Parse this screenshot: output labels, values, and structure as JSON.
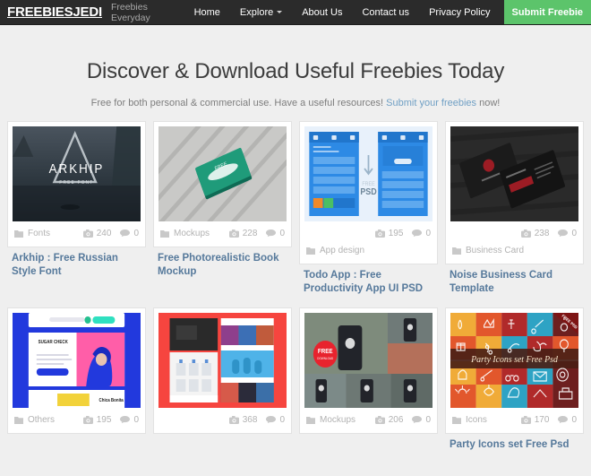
{
  "header": {
    "brand": "FREEBIESJEDI",
    "tagline": "Freebies Everyday",
    "nav": [
      {
        "label": "Home",
        "name": "nav-home",
        "caret": false
      },
      {
        "label": "Explore",
        "name": "nav-explore",
        "caret": true
      },
      {
        "label": "About Us",
        "name": "nav-about-us",
        "caret": false
      },
      {
        "label": "Contact us",
        "name": "nav-contact-us",
        "caret": false
      },
      {
        "label": "Privacy Policy",
        "name": "nav-privacy-policy",
        "caret": false
      }
    ],
    "submit_button": "Submit Freebie",
    "submit_button_color": "#5cc46b",
    "background_color": "#2b2b2b"
  },
  "hero": {
    "heading": "Discover & Download Useful Freebies Today",
    "sub_prefix": "Free for both personal & commercial use. Have a useful resources! ",
    "sub_link": "Submit your freebies",
    "sub_suffix": " now!",
    "link_color": "#6f9fc4"
  },
  "cards": [
    {
      "category": "Fonts",
      "views": "240",
      "comments": "0",
      "title": "Arkhip : Free Russian Style Font",
      "thumb": "arkhip-free-font-poster",
      "meta_stacked": false
    },
    {
      "category": "Mockups",
      "views": "228",
      "comments": "0",
      "title": "Free Photorealistic Book Mockup",
      "thumb": "green-book-on-wood-mockup",
      "meta_stacked": false
    },
    {
      "category": "App design",
      "views": "195",
      "comments": "0",
      "title": "Todo App : Free Productivity App UI PSD",
      "thumb": "blue-todo-app-ui-screens",
      "meta_stacked": true
    },
    {
      "category": "Business Card",
      "views": "238",
      "comments": "0",
      "title": "Noise Business Card Template",
      "thumb": "dark-noise-business-card",
      "meta_stacked": true
    },
    {
      "category": "Others",
      "views": "195",
      "comments": "0",
      "title": "",
      "thumb": "blue-hair-model-web-template",
      "meta_stacked": false
    },
    {
      "category": "",
      "views": "368",
      "comments": "0",
      "title": "",
      "thumb": "red-website-template-screens",
      "meta_stacked": false
    },
    {
      "category": "Mockups",
      "views": "206",
      "comments": "0",
      "title": "",
      "thumb": "phone-in-hand-photo-grid",
      "meta_stacked": false
    },
    {
      "category": "Icons",
      "views": "170",
      "comments": "0",
      "title": "Party Icons set Free Psd",
      "thumb": "party-icons-colored-grid",
      "meta_stacked": false
    }
  ],
  "icons": {
    "folder": "folder-icon",
    "camera": "camera-icon",
    "comment": "comment-icon"
  }
}
